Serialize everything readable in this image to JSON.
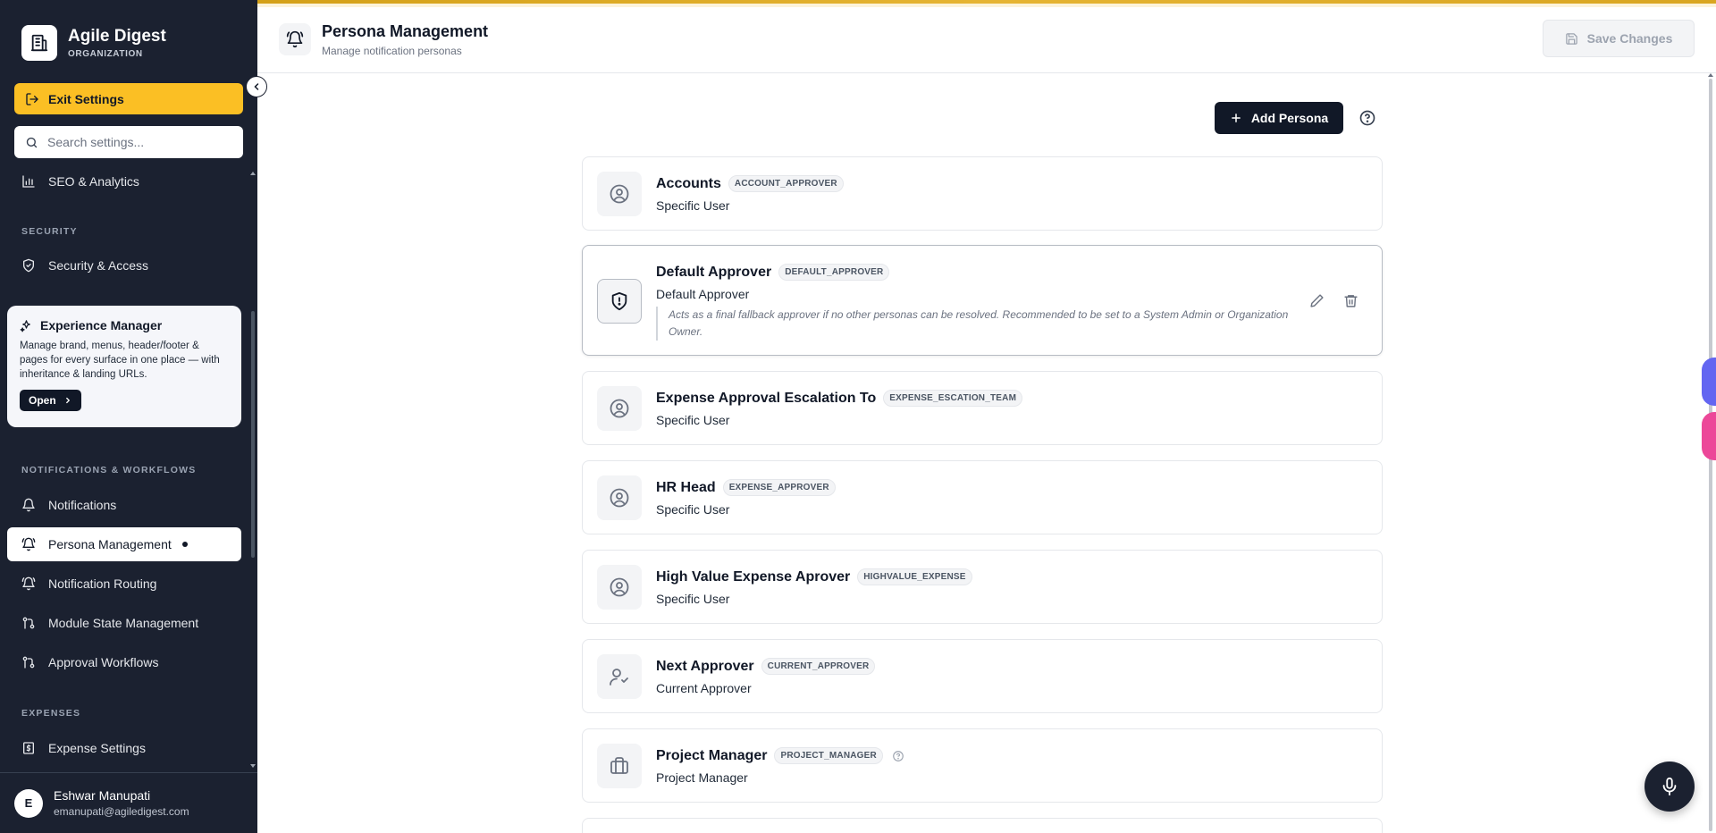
{
  "sidebar": {
    "brand_name": "Agile Digest",
    "brand_sub": "ORGANIZATION",
    "exit_label": "Exit Settings",
    "search_placeholder": "Search settings...",
    "items": {
      "seo": "SEO & Analytics",
      "security": "Security & Access",
      "notifications": "Notifications",
      "persona": "Persona Management",
      "routing": "Notification Routing",
      "module_state": "Module State Management",
      "approval": "Approval Workflows",
      "expense": "Expense Settings"
    },
    "sections": {
      "security": "SECURITY",
      "notifications": "NOTIFICATIONS & WORKFLOWS",
      "expenses": "EXPENSES"
    },
    "promo": {
      "title": "Experience Manager",
      "description": "Manage brand, menus, header/footer & pages for every surface in one place — with inheritance & landing URLs.",
      "open_label": "Open"
    },
    "user": {
      "initial": "E",
      "name": "Eshwar Manupati",
      "email": "emanupati@agiledigest.com"
    }
  },
  "header": {
    "title": "Persona Management",
    "subtitle": "Manage notification personas",
    "save_label": "Save Changes"
  },
  "main": {
    "add_label": "Add Persona"
  },
  "personas": [
    {
      "name": "Accounts",
      "code": "ACCOUNT_APPROVER",
      "type": "Specific User",
      "icon": "user-circle-icon"
    },
    {
      "name": "Default Approver",
      "code": "DEFAULT_APPROVER",
      "type": "Default Approver",
      "icon": "shield-alert-icon",
      "description": "Acts as a final fallback approver if no other personas can be resolved. Recommended to be set to a System Admin or Organization Owner."
    },
    {
      "name": "Expense Approval Escalation To",
      "code": "EXPENSE_ESCATION_TEAM",
      "type": "Specific User",
      "icon": "user-circle-icon"
    },
    {
      "name": "HR Head",
      "code": "EXPENSE_APPROVER",
      "type": "Specific User",
      "icon": "user-circle-icon"
    },
    {
      "name": "High Value Expense Aprover",
      "code": "HIGHVALUE_EXPENSE",
      "type": "Specific User",
      "icon": "user-circle-icon"
    },
    {
      "name": "Next Approver",
      "code": "CURRENT_APPROVER",
      "type": "Current Approver",
      "icon": "user-check-icon"
    },
    {
      "name": "Project Manager",
      "code": "PROJECT_MANAGER",
      "type": "Project Manager",
      "icon": "briefcase-icon"
    }
  ],
  "colors": {
    "sidebar_bg": "#1b2130",
    "accent": "#fbbf24",
    "primary_button": "#111827"
  }
}
